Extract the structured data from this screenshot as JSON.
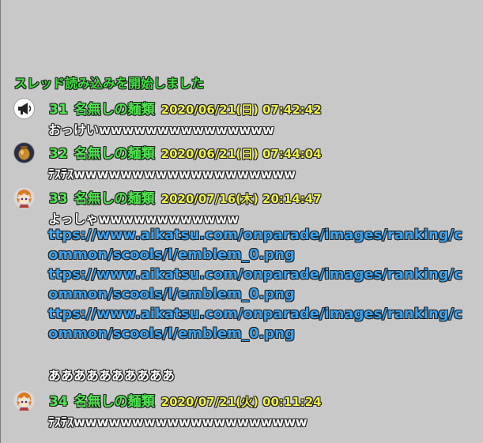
{
  "status_text": "スレッド読み込みを開始しました",
  "posts": [
    {
      "number": "31",
      "name": "名無しの麺類",
      "date": "2020/06/21(日) 07:42:42",
      "avatar_icon": "megaphone-icon",
      "lines": [
        "おっけいwwwwwwwwwwwwwww"
      ],
      "links": [],
      "trailing": ""
    },
    {
      "number": "32",
      "name": "名無しの麺類",
      "date": "2020/06/21(日) 07:44:04",
      "avatar_icon": "jar-icon",
      "lines": [
        "ﾃｽﾃｽwwwwwwwwwwwwwwwwwww"
      ],
      "links": [],
      "trailing": ""
    },
    {
      "number": "33",
      "name": "名無しの麺類",
      "date": "2020/07/16(木) 20:14:47",
      "avatar_icon": "character-icon",
      "lines": [
        "よっしゃwwwwwwwwwwww"
      ],
      "links": [
        [
          "ttps://www.aikatsu.com/onparade/images/ranking/c",
          "ommon/scools/l/emblem_0.png"
        ],
        [
          "ttps://www.aikatsu.com/onparade/images/ranking/c",
          "ommon/scools/l/emblem_0.png"
        ],
        [
          "ttps://www.aikatsu.com/onparade/images/ranking/c",
          "ommon/scools/l/emblem_0.png"
        ]
      ],
      "trailing": "ああああああああああ"
    },
    {
      "number": "34",
      "name": "名無しの麺類",
      "date": "2020/07/21(火) 00:11:24",
      "avatar_icon": "character-icon",
      "lines": [
        "ﾃｽﾃｽwwwwwwwwwwwwwwwwwwww"
      ],
      "links": [],
      "trailing": ""
    }
  ]
}
